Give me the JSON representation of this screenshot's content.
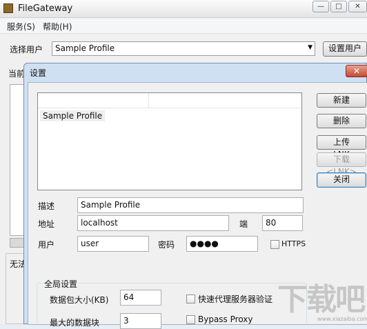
{
  "app": {
    "title": "FileGateway"
  },
  "window_controls": {
    "minimize": "—",
    "maximize": "□",
    "close": "✕"
  },
  "menu": [
    "服务(S)",
    "帮助(H)"
  ],
  "main": {
    "select_user_label": "选择用户",
    "selected_user": "Sample Profile",
    "setup_user_button": "设置用户",
    "current_label": "当前",
    "status_text": "无法"
  },
  "dialog": {
    "title": "设置",
    "close": "✕",
    "profiles": [
      "Sample Profile"
    ],
    "buttons": {
      "new": "新建",
      "delete": "删除",
      "upload": "上传 <LNK>",
      "download": "下载 <LNK>",
      "close": "关闭"
    },
    "fields": {
      "description_label": "描述",
      "description": "Sample Profile",
      "address_label": "地址",
      "address": "localhost",
      "port_label": "端",
      "port": "80",
      "user_label": "用户",
      "user": "user",
      "password_label": "密码",
      "password": "●●●●",
      "https_label": "HTTPS"
    },
    "global": {
      "title": "全局设置",
      "packet_size_label": "数据包大小(KB)",
      "packet_size": "64",
      "max_blocks_label": "最大的数据块",
      "max_blocks": "3",
      "fast_proxy_label": "快速代理服务器验证",
      "bypass_proxy_label": "Bypass Proxy"
    }
  },
  "watermark": {
    "text": "下载吧",
    "url": "www.xiazaiba.com"
  }
}
